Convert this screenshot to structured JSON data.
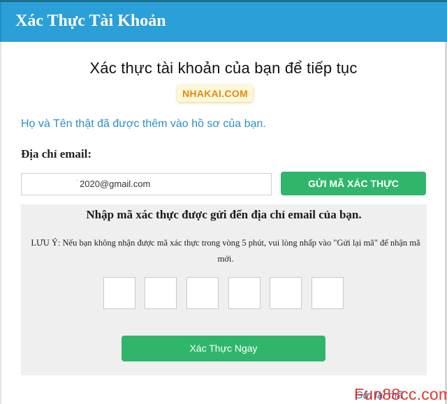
{
  "header": {
    "title": "Xác Thực Tài Khoản"
  },
  "main": {
    "heading": "Xác thực tài khoản của bạn để tiếp tục",
    "watermark": "NHAKAI.COM",
    "info": "Họ và Tên thật đã được thêm vào hồ sơ của bạn.",
    "email_label": "Địa chỉ email:",
    "email_value": "2020@gmail.com",
    "email_dot": ".",
    "send_code_label": "GỬI MÃ XÁC THỰC"
  },
  "verify_panel": {
    "title": "Nhập mã xác thực được gửi đến địa chỉ email của bạn.",
    "note": "LƯU Ý: Nếu bạn không nhận được mã xác thực trong vòng 5 phút, vui lòng nhấp vào \"Gửi lại mã\" để nhận mã mới.",
    "code_boxes": [
      "",
      "",
      "",
      "",
      "",
      ""
    ],
    "submit_label": "Xác Thực Ngay"
  },
  "footer": {
    "link": "Gửi lại mã",
    "brand_overlay": "Fun88cc.com"
  },
  "colors": {
    "header": "#2b9fd8",
    "button_green": "#2fb66a",
    "link_blue": "#2a8fbf",
    "brand_red": "#e0261c"
  }
}
